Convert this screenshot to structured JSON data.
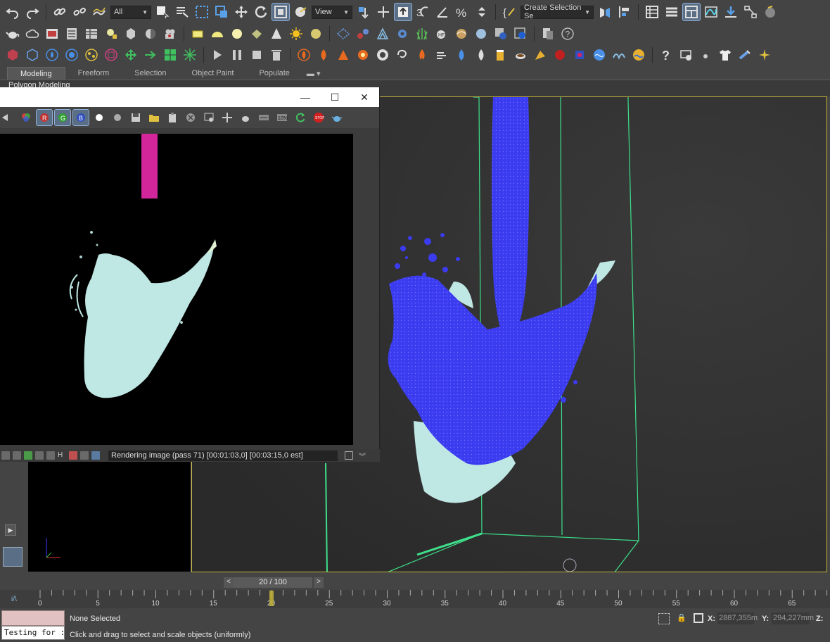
{
  "toolbar_main": {
    "selection_filter": "All",
    "reference_coord": "View",
    "named_selection": "Create Selection Se"
  },
  "ribbon": {
    "tabs": [
      "Modeling",
      "Freeform",
      "Selection",
      "Object Paint",
      "Populate"
    ],
    "active_tab": "Modeling",
    "sub_label": "Polygon Modeling"
  },
  "render_window": {
    "title_buttons": [
      "—",
      "☐",
      "✕"
    ],
    "status_text": "Rendering image (pass 71) [00:01:03,0] [00:03:15,0 est]"
  },
  "time_slider": {
    "frame_label": "20 / 100",
    "prev": "<",
    "next": ">",
    "current_frame": 20,
    "total_frames": 100
  },
  "trackbar": {
    "ticks": [
      "0",
      "5",
      "10",
      "15",
      "20",
      "25",
      "30",
      "35",
      "40",
      "45",
      "50",
      "55",
      "60",
      "65"
    ]
  },
  "status_bar": {
    "maxscript_input": "Testing for :",
    "selection": "None Selected",
    "prompt": "Click and drag to select and scale objects (uniformly)",
    "x_label": "X:",
    "x_value": "2887,355m",
    "y_label": "Y:",
    "y_value": "294,227mm",
    "z_label": "Z:"
  },
  "colors": {
    "accent": "#c2b33a",
    "particles": "#3b3bf0",
    "liquid": "#bfe7e4",
    "bounds": "#3ee08a",
    "emitter": "#d2269a"
  }
}
